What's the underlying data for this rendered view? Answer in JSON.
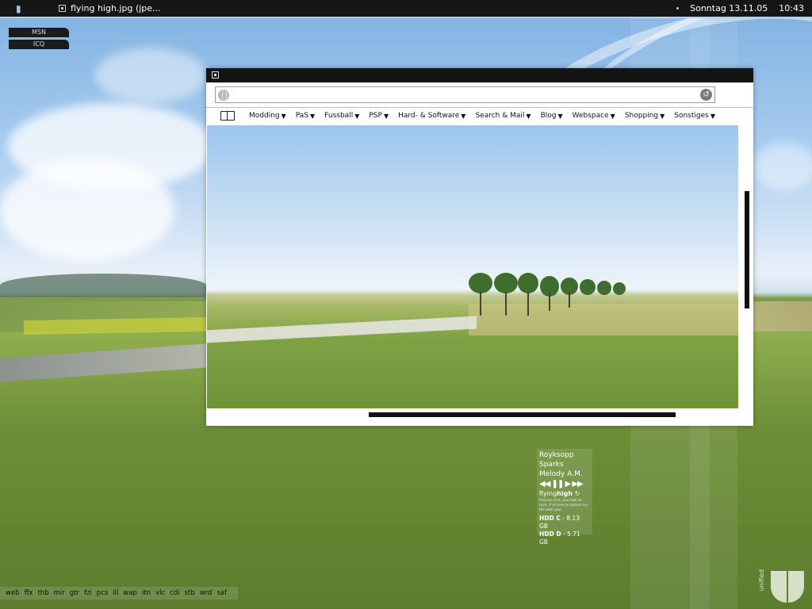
{
  "taskbar": {
    "task_title": "flying high.jpg (jpe...",
    "date": "Sonntag 13.11.05",
    "time": "10:43"
  },
  "quick_buttons": [
    "MSN",
    "ICQ"
  ],
  "browser": {
    "url": "",
    "menu": [
      {
        "label": "Modding"
      },
      {
        "label": "PaS"
      },
      {
        "label": "Fussball"
      },
      {
        "label": "PSP"
      },
      {
        "label": "Hard- & Software"
      },
      {
        "label": "Search & Mail"
      },
      {
        "label": "Blog"
      },
      {
        "label": "Webspace"
      },
      {
        "label": "Shopping"
      },
      {
        "label": "Sonstiges"
      }
    ],
    "icons": {
      "site": "globe-icon",
      "go": "refresh-icon",
      "bookmarks": "book-icon",
      "dropdown": "triangle-down-icon"
    }
  },
  "music": {
    "artist": "Royksopp",
    "album": "Sparks",
    "track": "Melody A.M.",
    "controls": "◀◀ ❚❚ ▶ ▶▶",
    "brand_prefix": "flying",
    "brand_bold": "high",
    "lyric": "Feel so nice, you feel so nice, if id love to spend my life with you",
    "hdd": [
      {
        "label": "HDD C",
        "value": " - 8.13 GB"
      },
      {
        "label": "HDD D",
        "value": " - 5.71 GB"
      }
    ]
  },
  "launcher": [
    "web",
    "ffx",
    "thb",
    "mir",
    "gtr",
    "fzi",
    "pcs",
    "ill",
    "wap",
    "itn",
    "vlc",
    "cdi",
    "stb",
    "wrd",
    "saf"
  ],
  "corner_logo": {
    "text": "unified"
  },
  "colors": {
    "taskbar": "#161616",
    "accent": "#b8d2ec",
    "window_title": "#141414"
  }
}
